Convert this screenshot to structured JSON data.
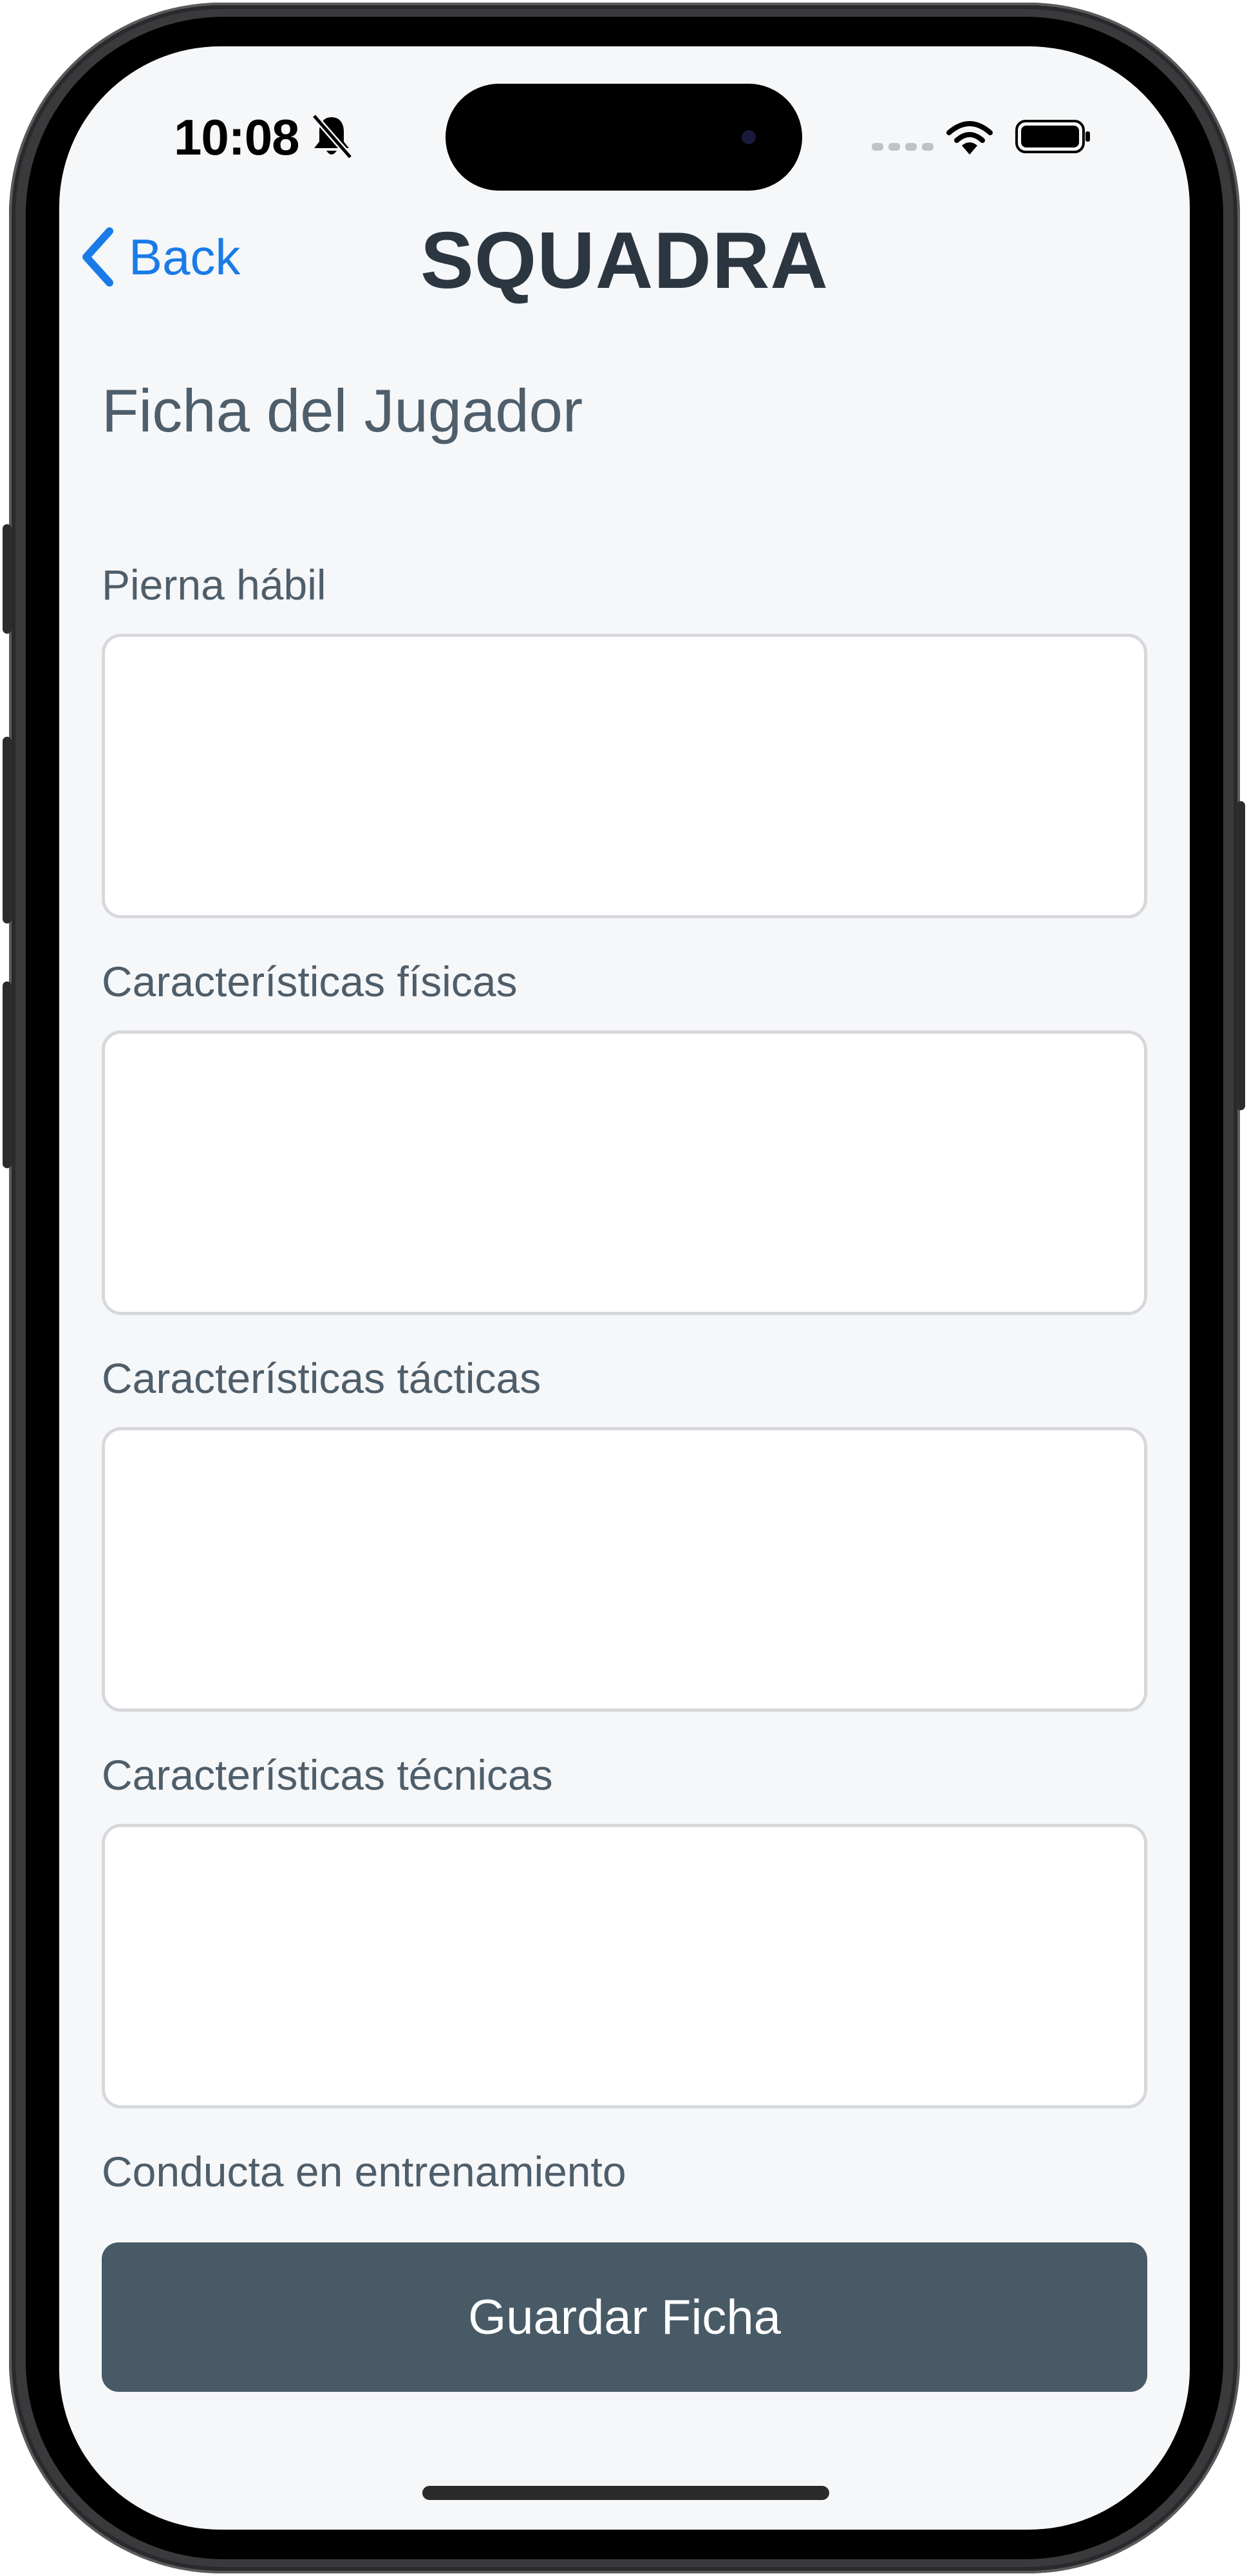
{
  "status_bar": {
    "time": "10:08",
    "icons": [
      "bell-slash-icon",
      "cellular-signal-icon",
      "wifi-icon",
      "battery-icon"
    ]
  },
  "nav": {
    "back_label": "Back",
    "title": "SQUADRA",
    "accent_color": "#1a7be8"
  },
  "page": {
    "title": "Ficha del Jugador"
  },
  "form": {
    "fields": [
      {
        "label": "Pierna hábil",
        "value": ""
      },
      {
        "label": "Características físicas",
        "value": ""
      },
      {
        "label": "Características tácticas",
        "value": ""
      },
      {
        "label": "Características técnicas",
        "value": ""
      },
      {
        "label": "Conducta en entrenamiento",
        "value": ""
      }
    ],
    "save_label": "Guardar Ficha",
    "save_color": "#485a66"
  }
}
